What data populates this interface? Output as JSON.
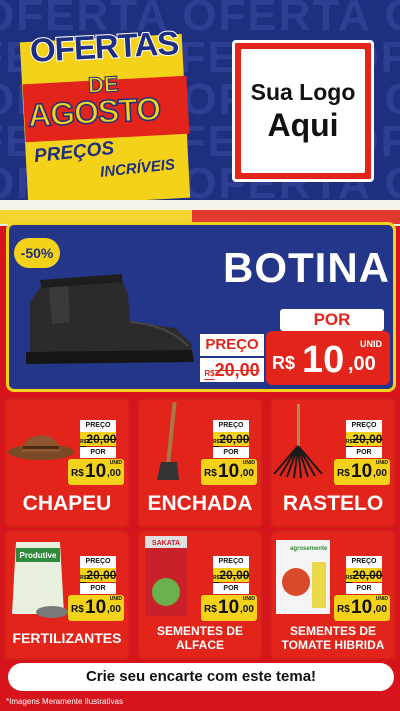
{
  "header": {
    "bg_word": "OFERTA",
    "title_line1": "OFERTAS",
    "title_line2": "DE",
    "title_line3": "AGOSTO",
    "tagline_1": "PREÇOS",
    "tagline_2": "INCRÍVEIS",
    "logo_line1": "Sua Logo",
    "logo_line2": "Aqui"
  },
  "hero": {
    "discount": "-50%",
    "name": "BOTINA",
    "por_label": "POR",
    "preco_label": "PREÇO",
    "old_currency": "R$",
    "old_price": "20,00",
    "currency": "R$",
    "price_int": "10",
    "price_cents": ",00",
    "unit": "UNID"
  },
  "products": [
    {
      "name": "CHAPEU",
      "preco": "PREÇO",
      "old_rs": "R$",
      "old": "20,00",
      "por": "POR",
      "rs": "R$",
      "v": "10",
      "c": ",00",
      "u": "UNID"
    },
    {
      "name": "ENCHADA",
      "preco": "PREÇO",
      "old_rs": "R$",
      "old": "20,00",
      "por": "POR",
      "rs": "R$",
      "v": "10",
      "c": ",00",
      "u": "UNID"
    },
    {
      "name": "RASTELO",
      "preco": "PREÇO",
      "old_rs": "R$",
      "old": "20,00",
      "por": "POR",
      "rs": "R$",
      "v": "10",
      "c": ",00",
      "u": "UNID"
    },
    {
      "name": "FERTILIZANTES",
      "preco": "PREÇO",
      "old_rs": "R$",
      "old": "20,00",
      "por": "POR",
      "rs": "R$",
      "v": "10",
      "c": ",00",
      "u": "UNID",
      "pack_label": "Produtive"
    },
    {
      "name": "SEMENTES DE ALFACE",
      "name1": "SEMENTES DE",
      "name2": "ALFACE",
      "preco": "PREÇO",
      "old_rs": "R$",
      "old": "20,00",
      "por": "POR",
      "rs": "R$",
      "v": "10",
      "c": ",00",
      "u": "UNID",
      "pack_label": "SAKATA"
    },
    {
      "name": "SEMENTES DE TOMATE HIBRIDA",
      "name1": "SEMENTES DE",
      "name2": "TOMATE HIBRIDA",
      "preco": "PREÇO",
      "old_rs": "R$",
      "old": "20,00",
      "por": "POR",
      "rs": "R$",
      "v": "10",
      "c": ",00",
      "u": "UNID",
      "pack_label": "agrosemente"
    }
  ],
  "cta": "Crie seu encarte com este tema!",
  "footnote": "*Imagens Meramente Ilustrativas",
  "colors": {
    "navy": "#1f2f7f",
    "red": "#e2241b",
    "yellow": "#f4d21a",
    "white": "#ffffff"
  }
}
